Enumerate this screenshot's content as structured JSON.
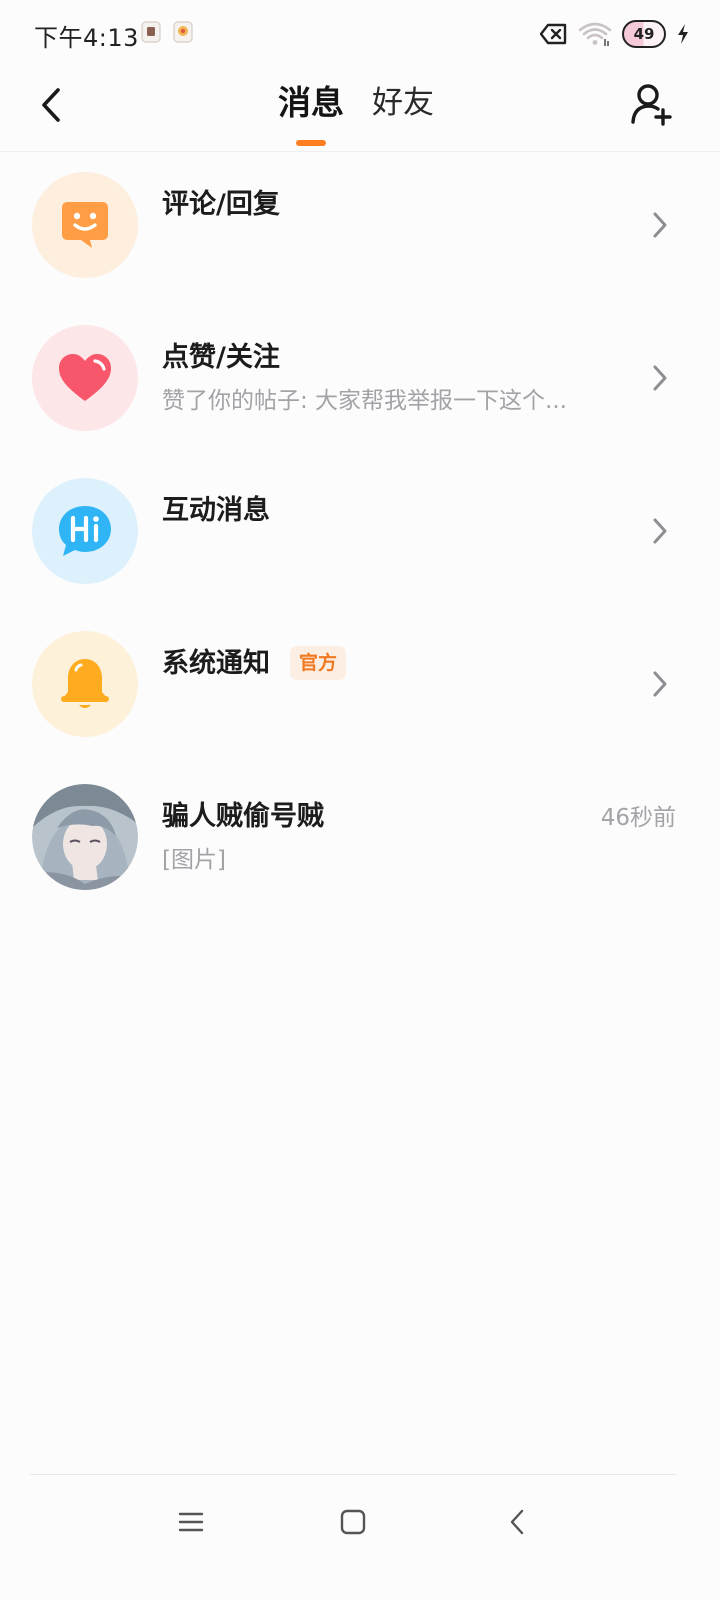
{
  "status_bar": {
    "time": "下午4:13",
    "battery_level": "49",
    "icons": [
      "app-notification-icon",
      "app-notification-icon",
      "no-sim-icon",
      "wifi-icon",
      "battery-icon",
      "charging-icon"
    ]
  },
  "header": {
    "tabs": [
      {
        "label": "消息",
        "active": true
      },
      {
        "label": "好友",
        "active": false
      }
    ],
    "accent_color": "#ff7e21"
  },
  "messages": [
    {
      "title": "评论/回复",
      "subtitle": "",
      "icon": "comment-smile-icon",
      "icon_bg": "#fdeedd",
      "icon_color": "#ff9d45"
    },
    {
      "title": "点赞/关注",
      "subtitle": "赞了你的帖子: 大家帮我举报一下这个...",
      "icon": "heart-icon",
      "icon_bg": "#fde6e8",
      "icon_color": "#f7566b"
    },
    {
      "title": "互动消息",
      "subtitle": "",
      "icon": "hi-chat-icon",
      "icon_bg": "#ddf1fd",
      "icon_color": "#2fb5f5"
    },
    {
      "title": "系统通知",
      "badge": "官方",
      "subtitle": "",
      "icon": "bell-icon",
      "icon_bg": "#fef1d9",
      "icon_color": "#ffab1f"
    },
    {
      "title": "骗人贼偷号贼",
      "subtitle": "[图片]",
      "time": "46秒前",
      "icon": "user-avatar"
    }
  ],
  "nav": {
    "buttons": [
      "menu-icon",
      "home-icon",
      "back-icon"
    ]
  }
}
